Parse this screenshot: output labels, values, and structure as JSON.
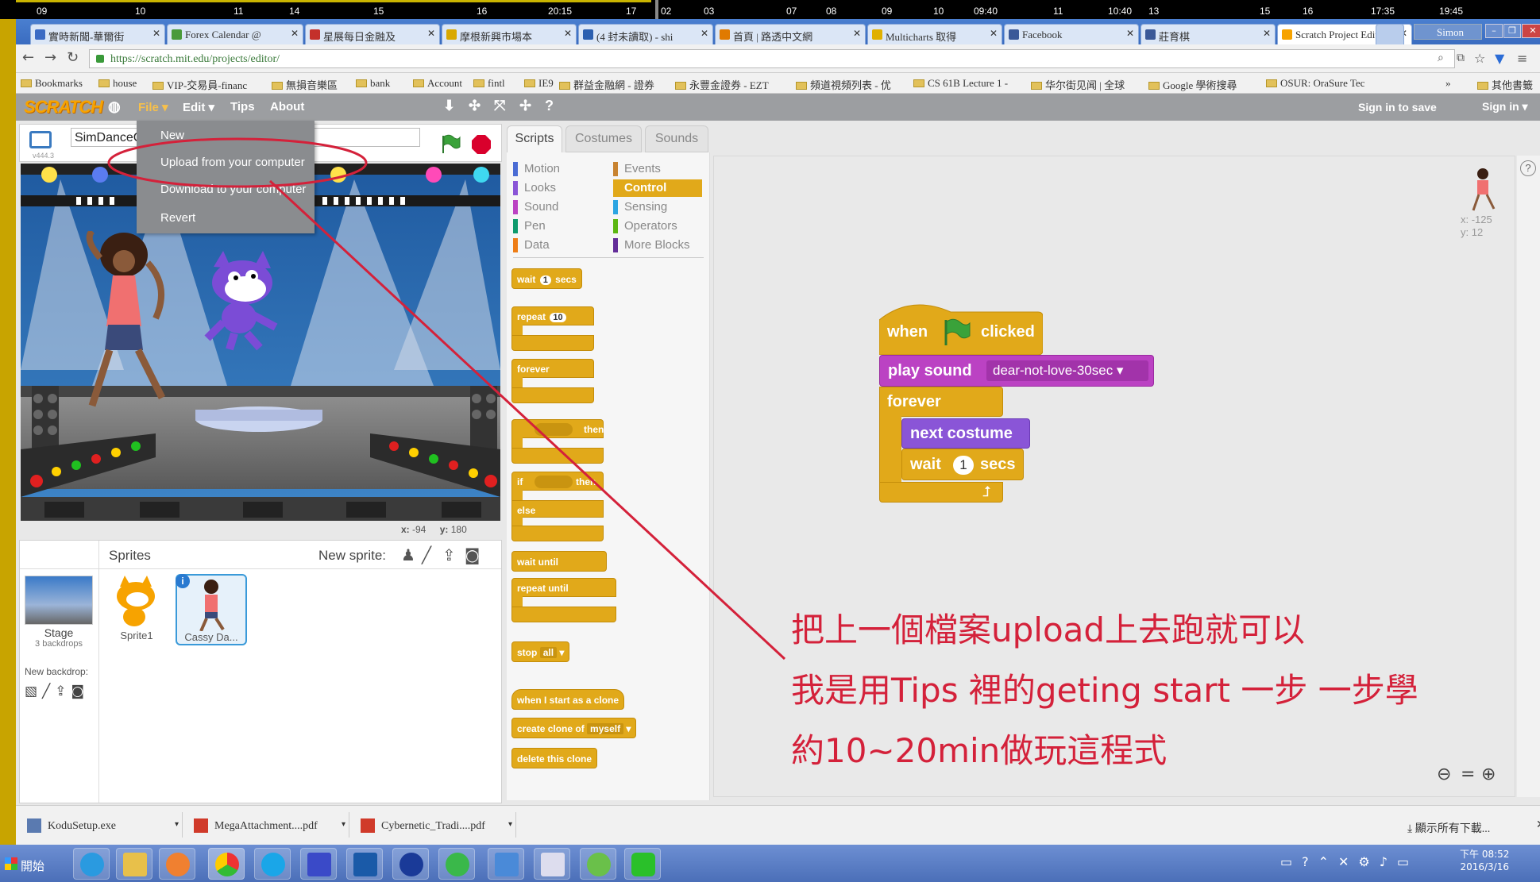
{
  "timeline": {
    "ticks": [
      "09",
      "10",
      "11",
      "14",
      "15",
      "16",
      "20:15",
      "17",
      "02",
      "03",
      "07",
      "08",
      "09",
      "10",
      "09:40",
      "11",
      "10:40",
      "13",
      "15",
      "16",
      "17:35",
      "19:45"
    ]
  },
  "browser": {
    "tabs": [
      {
        "label": "實時新聞-華爾街",
        "icon_color": "#3b6bc4"
      },
      {
        "label": "Forex Calendar @",
        "icon_color": "#4a9a3a"
      },
      {
        "label": "星展每日金融及",
        "icon_color": "#c4302b"
      },
      {
        "label": "摩根新興市場本",
        "icon_color": "#d9a800"
      },
      {
        "label": "(4 封未讀取) - shi",
        "icon_color": "#2b5fb0"
      },
      {
        "label": "首頁 | 路透中文網",
        "icon_color": "#e07a00"
      },
      {
        "label": "Multicharts 取得",
        "icon_color": "#e0b000"
      },
      {
        "label": "Facebook",
        "icon_color": "#3b5998"
      },
      {
        "label": "莊育棋",
        "icon_color": "#3b5998"
      },
      {
        "label": "Scratch Project Edit",
        "icon_color": "#f7a300"
      }
    ],
    "user": "Simon",
    "url": "https://scratch.mit.edu/projects/editor/",
    "bookmarks": [
      "Bookmarks",
      "house",
      "VIP-交易員-financ",
      "無損音樂區",
      "bank",
      "Account",
      "fintl",
      "IE9",
      "群益金融網 - 證券",
      "永豐金證券 - EZT",
      "頻道視頻列表 - 优",
      "CS 61B Lecture 1 -",
      "华尔街见闻 | 全球",
      "Google 學術搜尋",
      "OSUR: OraSure Tec",
      "其他書籤"
    ]
  },
  "scratch": {
    "logo": "SCRATCH",
    "menu": {
      "file": "File ▾",
      "edit": "Edit ▾",
      "tips": "Tips",
      "about": "About"
    },
    "sign_in_to_save": "Sign in to save",
    "sign_in": "Sign in ▾",
    "file_menu": [
      "New",
      "Upload from your computer",
      "Download to your computer",
      "Revert"
    ],
    "version": "v444.3",
    "project_name": "SimDanceC",
    "stage_coords": {
      "x_label": "x:",
      "x": "-94",
      "y_label": "y:",
      "y": "180"
    },
    "tabs": [
      "Scripts",
      "Costumes",
      "Sounds"
    ],
    "categories_left": [
      {
        "name": "Motion",
        "color": "#4a6cd4"
      },
      {
        "name": "Looks",
        "color": "#8a55d7"
      },
      {
        "name": "Sound",
        "color": "#bb42c3"
      },
      {
        "name": "Pen",
        "color": "#0e9a6c"
      },
      {
        "name": "Data",
        "color": "#ee7d16"
      }
    ],
    "categories_right": [
      {
        "name": "Events",
        "color": "#c88330"
      },
      {
        "name": "Control",
        "color": "#e1a91a"
      },
      {
        "name": "Sensing",
        "color": "#2ca5e2"
      },
      {
        "name": "Operators",
        "color": "#5cb712"
      },
      {
        "name": "More Blocks",
        "color": "#632d99"
      }
    ],
    "palette_blocks": {
      "wait": "wait",
      "wait_num": "1",
      "secs": "secs",
      "repeat": "repeat",
      "repeat_num": "10",
      "forever": "forever",
      "then": "then",
      "if": "if",
      "then2": "then",
      "else": "else",
      "wait_until": "wait until",
      "repeat_until": "repeat until",
      "stop": "stop",
      "stop_opt": "all",
      "when_clone": "when I start as a clone",
      "create_clone": "create clone of",
      "clone_opt": "myself",
      "delete_clone": "delete this clone"
    },
    "script": {
      "when": "when",
      "clicked": "clicked",
      "play_sound": "play sound",
      "sound_name": "dear-not-love-30sec",
      "forever": "forever",
      "next_costume": "next costume",
      "wait": "wait",
      "wait_num": "1",
      "secs": "secs"
    },
    "sprite_info": {
      "x": "x: -125",
      "y": "y: 12"
    },
    "sprites_pane": {
      "title": "Sprites",
      "new_sprite": "New sprite:",
      "stage_label": "Stage",
      "backdrops": "3 backdrops",
      "new_backdrop": "New backdrop:",
      "sprites": [
        "Sprite1",
        "Cassy Da..."
      ]
    }
  },
  "annotation": {
    "line1": "把上一個檔案upload上去跑就可以",
    "line2": "我是用Tips 裡的geting start 一步 一步學",
    "line3": "約10~20min做玩這程式",
    "color": "#d4213a"
  },
  "downloads": {
    "items": [
      "KoduSetup.exe",
      "MegaAttachment....pdf",
      "Cybernetic_Tradi....pdf"
    ],
    "show_all": "顯示所有下載..."
  },
  "taskbar": {
    "start": "開始",
    "time": "下午 08:52",
    "date": "2016/3/16"
  }
}
